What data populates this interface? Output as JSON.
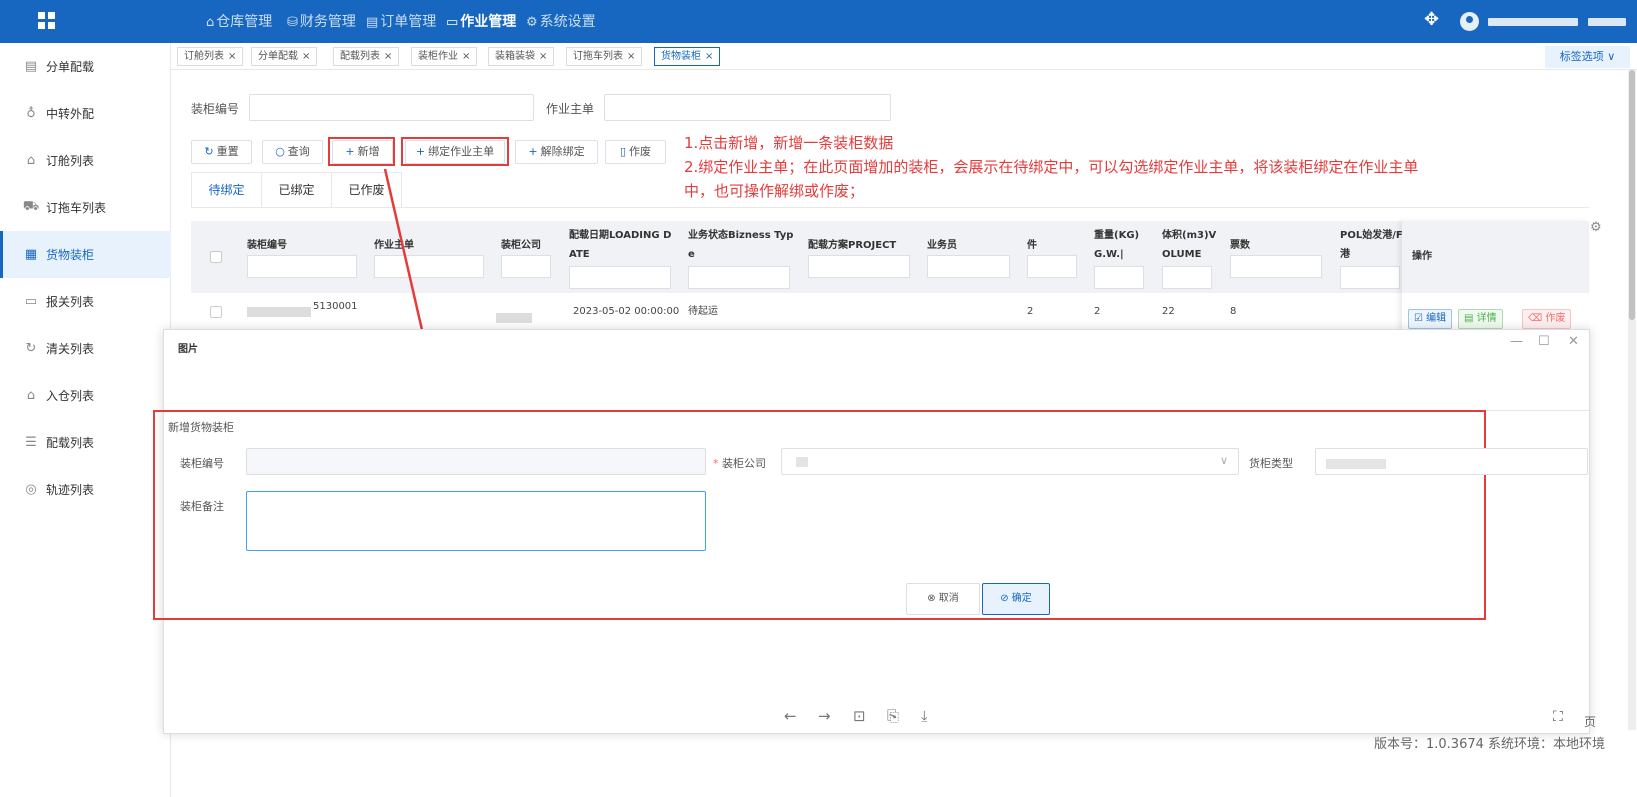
{
  "topbar": {
    "nav": [
      {
        "icon": "home-outline-icon",
        "glyph": "⌂",
        "label": "仓库管理"
      },
      {
        "icon": "database-icon",
        "glyph": "⛁",
        "label": "财务管理"
      },
      {
        "icon": "document-icon",
        "glyph": "▤",
        "label": "订单管理"
      },
      {
        "icon": "folder-icon",
        "glyph": "▭",
        "label": "作业管理"
      },
      {
        "icon": "gear-icon",
        "glyph": "⚙",
        "label": "系统设置"
      }
    ],
    "active": "作业管理",
    "move_glyph": "✥"
  },
  "sidebar": {
    "items": [
      {
        "glyph": "▤",
        "label": "分单配载"
      },
      {
        "glyph": "♁",
        "label": "中转外配"
      },
      {
        "glyph": "⌂",
        "label": "订舱列表"
      },
      {
        "glyph": "⛟",
        "label": "订拖车列表"
      },
      {
        "glyph": "▦",
        "label": "货物装柜"
      },
      {
        "glyph": "▭",
        "label": "报关列表"
      },
      {
        "glyph": "↻",
        "label": "清关列表"
      },
      {
        "glyph": "⌂",
        "label": "入仓列表"
      },
      {
        "glyph": "☰",
        "label": "配载列表"
      },
      {
        "glyph": "◎",
        "label": "轨迹列表"
      }
    ],
    "active": "货物装柜"
  },
  "page_tabs": [
    {
      "label": "订舱列表"
    },
    {
      "label": "分单配载"
    },
    {
      "label": "配载列表"
    },
    {
      "label": "装柜作业"
    },
    {
      "label": "装箱装袋"
    },
    {
      "label": "订拖车列表"
    },
    {
      "label": "货物装柜"
    }
  ],
  "page_tabs_active": "货物装柜",
  "tab_close_glyph": "×",
  "tag_options": "标签选项 ∨",
  "filters": {
    "container_no_label": "装柜编号",
    "master_order_label": "作业主单"
  },
  "toolbar": {
    "reset": "重置",
    "query": "查询",
    "add": "新增",
    "bind": "绑定作业主单",
    "unbind": "解除绑定",
    "void": "作废",
    "reset_glyph": "↻",
    "query_glyph": "○",
    "add_glyph": "+",
    "void_glyph": "▯"
  },
  "annotations": {
    "line1": "1.点击新增，新增一条装柜数据",
    "line2": "2.绑定作业主单；在此页面增加的装柜，会展示在待绑定中，可以勾选绑定作业主单，将该装柜绑定在作业主单",
    "line3": "中，也可操作解绑或作废；"
  },
  "status_tabs": {
    "pending": "待绑定",
    "bound": "已绑定",
    "voided": "已作废"
  },
  "table": {
    "columns": {
      "container_no": "装柜编号",
      "master_order": "作业主单",
      "company": "装柜公司",
      "date_a": "配载日期LOADING D",
      "date_b": "ATE",
      "status_a": "业务状态Bizness Typ",
      "status_b": "e",
      "project": "配载方案PROJECT",
      "salesman": "业务员",
      "pieces": "件",
      "weight_a": "重量(KG)",
      "weight_b": "G.W.|",
      "volume_a": "体积(m3)V",
      "volume_b": "OLUME",
      "tickets": "票数",
      "pol_a": "POL始发港/F",
      "pol_b": "港",
      "ops": "操作"
    },
    "row": {
      "container_no_suffix": "5130001",
      "date": "2023-05-02 00:00:00",
      "status": "待起运",
      "pieces": "2",
      "weight": "2",
      "volume": "22",
      "tickets": "8"
    },
    "ops": {
      "edit": "编辑",
      "detail": "详情",
      "void": "作废",
      "edit_glyph": "☑",
      "detail_glyph": "▤",
      "void_glyph": "⌫"
    },
    "settings_glyph": "⚙"
  },
  "viewer": {
    "title": "图片",
    "minimize": "—",
    "maximize": "☐",
    "close": "✕",
    "tools": [
      "←",
      "→",
      "⊡",
      "⎘",
      "⤓"
    ],
    "scan_glyph": "⛶"
  },
  "dialog": {
    "title": "新增货物装柜",
    "container_no_label": "装柜编号",
    "company_label": "装柜公司",
    "required_mark": "*",
    "type_label": "货柜类型",
    "remark_label": "装柜备注",
    "chevron": "∨",
    "cancel": "取消",
    "confirm": "确定",
    "cancel_glyph": "⊗",
    "confirm_glyph": "⊘"
  },
  "footer": {
    "version": "版本号：1.0.3674 系统环境：本地环境",
    "page_suffix": "页"
  },
  "colors": {
    "primary": "#1767c0",
    "annotation_red": "#e43b3b",
    "edit_blue": "#1767c0",
    "detail_green": "#4caf50",
    "void_red": "#f56c6c"
  }
}
